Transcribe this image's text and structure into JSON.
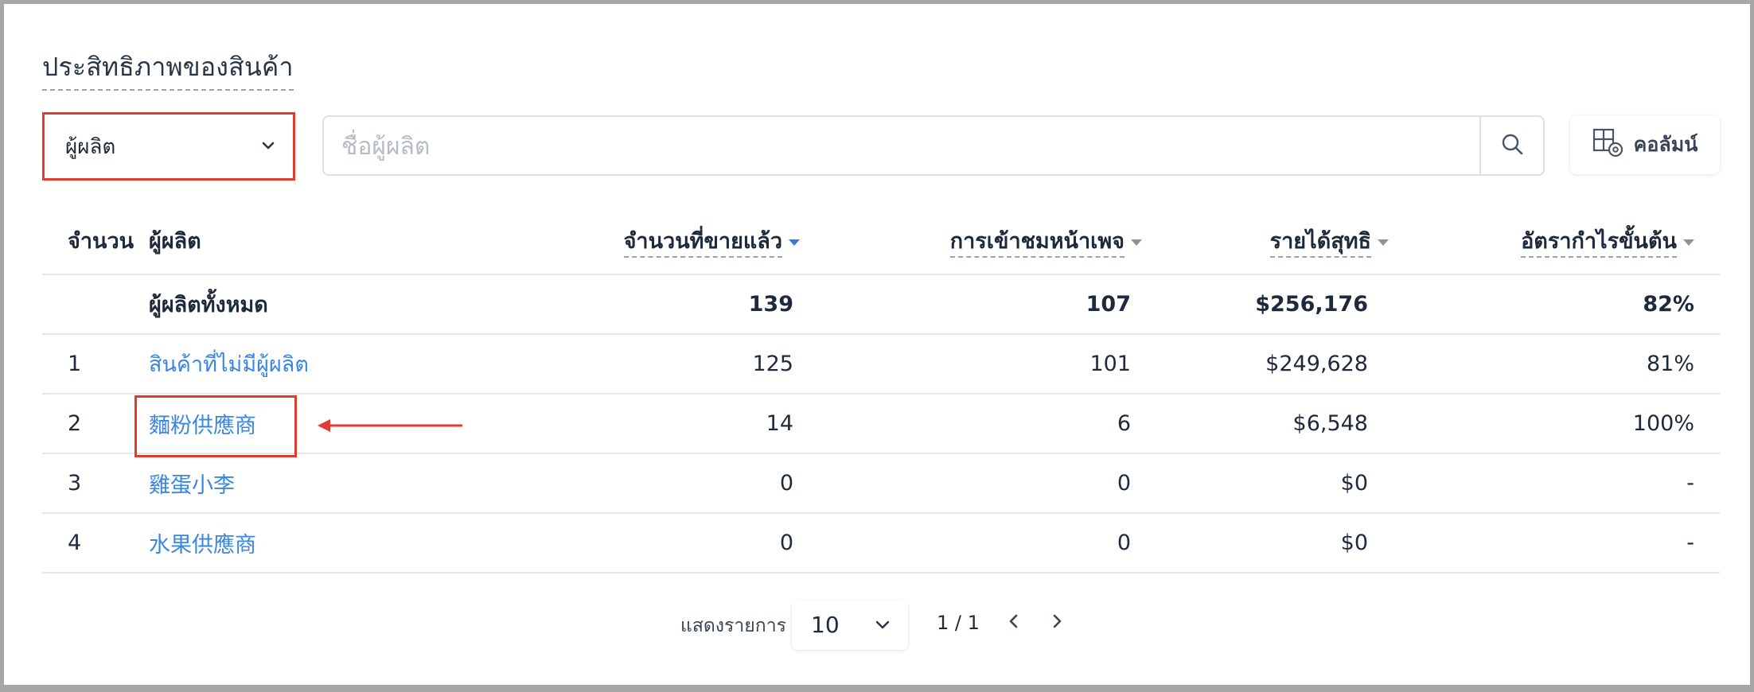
{
  "page_title": "ประสิทธิภาพของสินค้า",
  "filter_dropdown": {
    "selected": "ผู้ผลิต"
  },
  "search": {
    "placeholder": "ชื่อผู้ผลิต",
    "value": ""
  },
  "columns_button": {
    "label": "คอลัมน์"
  },
  "table": {
    "headers": {
      "index": "จำนวน",
      "vendor": "ผู้ผลิต",
      "units_sold": "จำนวนที่ขายแล้ว",
      "page_views": "การเข้าชมหน้าเพจ",
      "net_revenue": "รายได้สุทธิ",
      "gross_margin": "อัตรากำไรขั้นต้น"
    },
    "total": {
      "vendor": "ผู้ผลิตทั้งหมด",
      "units_sold": "139",
      "page_views": "107",
      "net_revenue": "$256,176",
      "gross_margin": "82%"
    },
    "rows": [
      {
        "index": "1",
        "vendor": "สินค้าที่ไม่มีผู้ผลิต",
        "units_sold": "125",
        "page_views": "101",
        "net_revenue": "$249,628",
        "gross_margin": "81%"
      },
      {
        "index": "2",
        "vendor": "麵粉供應商",
        "units_sold": "14",
        "page_views": "6",
        "net_revenue": "$6,548",
        "gross_margin": "100%"
      },
      {
        "index": "3",
        "vendor": "雞蛋小李",
        "units_sold": "0",
        "page_views": "0",
        "net_revenue": "$0",
        "gross_margin": "-"
      },
      {
        "index": "4",
        "vendor": "水果供應商",
        "units_sold": "0",
        "page_views": "0",
        "net_revenue": "$0",
        "gross_margin": "-"
      }
    ]
  },
  "pagination": {
    "rows_label": "แสดงรายการ",
    "page_size": "10",
    "page_indicator": "1 / 1"
  },
  "colors": {
    "link": "#3a86e0",
    "highlight": "#e03b2e",
    "sort_active": "#3a7bd5"
  }
}
